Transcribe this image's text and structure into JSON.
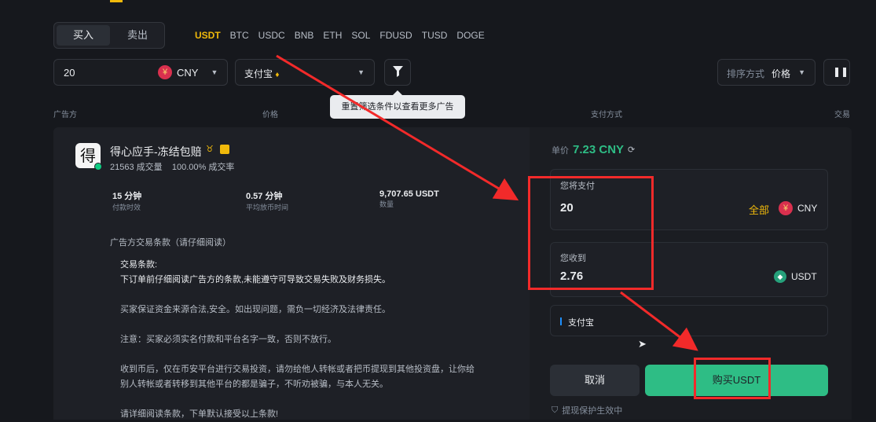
{
  "tabs": {
    "buy": "买入",
    "sell": "卖出"
  },
  "coins": [
    "USDT",
    "BTC",
    "USDC",
    "BNB",
    "ETH",
    "SOL",
    "FDUSD",
    "TUSD",
    "DOGE"
  ],
  "filters": {
    "amount": "20",
    "currency": "CNY",
    "payment": "支付宝",
    "sort_label": "排序方式",
    "sort_value": "价格",
    "tooltip": "重置筛选条件以查看更多广告"
  },
  "columns": {
    "advertiser": "广告方",
    "price": "价格",
    "payment": "支付方式",
    "trade": "交易"
  },
  "merchant": {
    "name": "得心应手-冻结包赔",
    "avatar_char": "得",
    "orders": "21563 成交量",
    "completion": "100.00% 成交率",
    "stats": [
      {
        "value": "15 分钟",
        "label": "付款时效"
      },
      {
        "value": "0.57 分钟",
        "label": "平均放币时间"
      },
      {
        "value": "9,707.65 USDT",
        "label": "数量"
      }
    ]
  },
  "terms": {
    "title": "广告方交易条款（请仔细阅读）",
    "lines": [
      "交易条款:",
      "下订单前仔细阅读广告方的条款,未能遵守可导致交易失败及财务损失。",
      "买家保证资金来源合法,安全。如出现问题，需负一切经济及法律责任。",
      "注意：买家必须实名付款和平台名字一致，否则不放行。",
      "收到币后，仅在币安平台进行交易投资，请勿给他人转帐或者把币提现到其他投资盘，让你给",
      "别人转帐或者转移到其他平台的都是骗子，不听劝被骗，与本人无关。",
      "请详细阅读条款，下单默认接受以上条款!"
    ]
  },
  "order": {
    "price_label": "单价",
    "price": "7.23 CNY",
    "pay_label": "您将支付",
    "pay_value": "20",
    "all_label": "全部",
    "pay_currency": "CNY",
    "receive_label": "您收到",
    "receive_value": "2.76",
    "receive_currency": "USDT",
    "payment_method": "支付宝",
    "cancel": "取消",
    "buy": "购买USDT",
    "protection": "提现保护生效中"
  },
  "colors": {
    "accent": "#f0b90b",
    "green": "#2ebd85",
    "annotation": "#f22a2a"
  }
}
